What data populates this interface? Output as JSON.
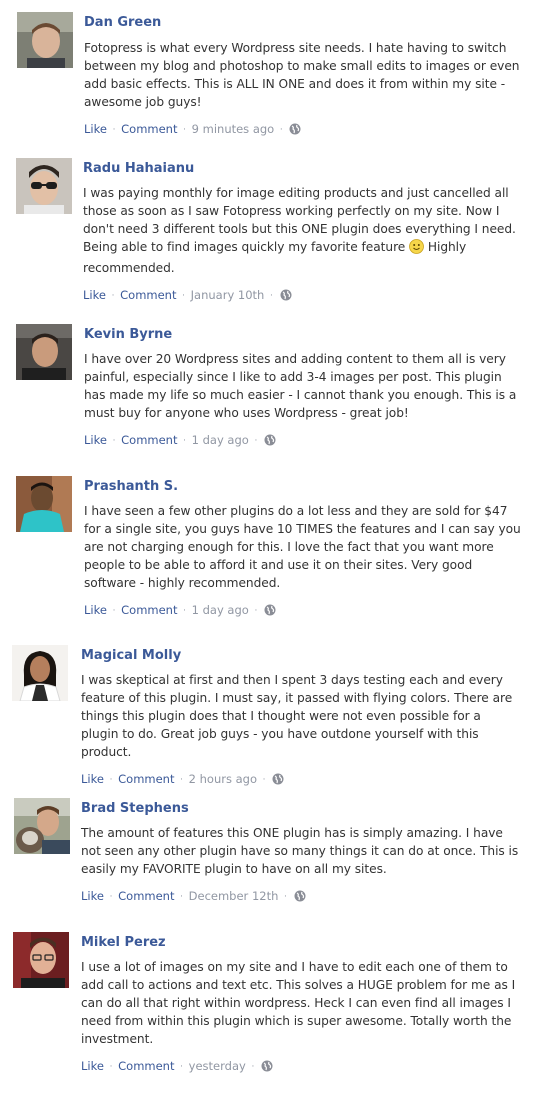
{
  "separator_text": "·",
  "colors": {
    "name": "#3b5998",
    "link": "#3b5998",
    "body_text": "#333333",
    "meta": "#9197a3"
  },
  "comments": [
    {
      "name": "Dan Green",
      "text": "Fotopress is what every Wordpress site needs. I hate having to switch between my blog and photoshop to make small edits to images or even add basic effects. This is ALL IN ONE and does it from within my site - awesome job guys!",
      "like_label": "Like",
      "comment_label": "Comment",
      "time": "9 minutes ago",
      "avatar_icon": "avatar-photo"
    },
    {
      "name": "Radu Hahaianu",
      "text": "I was paying monthly for image editing products and just cancelled all those as soon as I saw Fotopress working perfectly on my site. Now I don't need 3 different tools but this ONE plugin does everything I need. Being able to find images quickly my favorite feature",
      "text_after": "Highly recommended.",
      "emoji_icon": "smiley-icon",
      "like_label": "Like",
      "comment_label": "Comment",
      "time": "January 10th",
      "avatar_icon": "avatar-photo"
    },
    {
      "name": "Kevin Byrne",
      "text": "I have over 20 Wordpress sites and adding content to them all is very painful, especially since I like to add 3-4 images per post. This plugin has made my life so much easier - I cannot thank you enough. This is a must buy for anyone who uses Wordpress - great job!",
      "like_label": "Like",
      "comment_label": "Comment",
      "time": "1 day ago",
      "avatar_icon": "avatar-photo"
    },
    {
      "name": "Prashanth S.",
      "text": "I have seen a few other plugins do a lot less and they are sold for $47 for a single site, you guys have 10 TIMES the features and I can say you are not charging enough for this. I love the fact that you want more people to be able to afford it and use it on their sites. Very good software - highly recommended.",
      "like_label": "Like",
      "comment_label": "Comment",
      "time": "1 day ago",
      "avatar_icon": "avatar-photo"
    },
    {
      "name": "Magical Molly",
      "text": "I was skeptical at first and then I spent 3 days testing each and every feature of this plugin. I must say, it passed with flying colors. There are things this plugin does that I thought were not even possible for a plugin to do. Great job guys - you have outdone yourself with this product.",
      "like_label": "Like",
      "comment_label": "Comment",
      "time": "2 hours ago",
      "avatar_icon": "avatar-photo"
    },
    {
      "name": "Brad Stephens",
      "text": "The amount of features this ONE plugin has is simply amazing. I have not seen any other plugin have so many things it can do at once. This is easily my FAVORITE plugin to have on all my sites.",
      "like_label": "Like",
      "comment_label": "Comment",
      "time": "December 12th",
      "avatar_icon": "avatar-photo"
    },
    {
      "name": "Mikel Perez",
      "text": "I use a lot of images on my site and I have to edit each one of them to add call to actions and text etc. This solves a HUGE problem for me as I can do all that right within wordpress. Heck I can even find all images I need from within this plugin which is super awesome. Totally worth the investment.",
      "like_label": "Like",
      "comment_label": "Comment",
      "time": "yesterday",
      "avatar_icon": "avatar-photo"
    }
  ]
}
